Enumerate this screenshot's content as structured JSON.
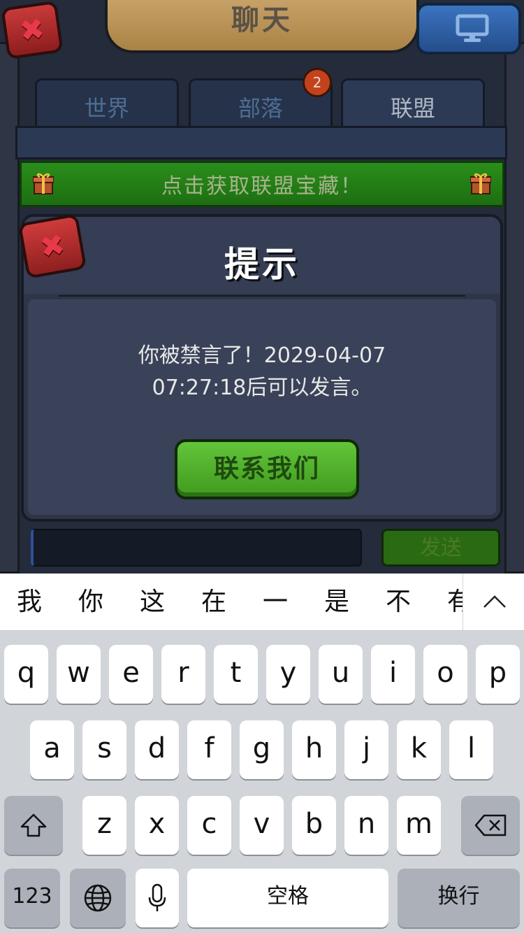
{
  "game": {
    "title": "聊天",
    "tabs": [
      {
        "label": "世界",
        "active": false
      },
      {
        "label": "部落",
        "active": false,
        "badge": "2"
      },
      {
        "label": "联盟",
        "active": true
      }
    ],
    "treasure_banner": "点击获取联盟宝藏！",
    "send_label": "发送"
  },
  "dialog": {
    "title": "提示",
    "message_line1": "你被禁言了！2029-04-07",
    "message_line2": "07:27:18后可以发言。",
    "contact_label": "联系我们"
  },
  "keyboard": {
    "candidates": [
      "我",
      "你",
      "这",
      "在",
      "一",
      "是",
      "不",
      "有"
    ],
    "row1": [
      "q",
      "w",
      "e",
      "r",
      "t",
      "y",
      "u",
      "i",
      "o",
      "p"
    ],
    "row2": [
      "a",
      "s",
      "d",
      "f",
      "g",
      "h",
      "j",
      "k",
      "l"
    ],
    "row3": [
      "z",
      "x",
      "c",
      "v",
      "b",
      "n",
      "m"
    ],
    "numbers_label": "123",
    "space_label": "空格",
    "return_label": "换行"
  },
  "colors": {
    "treasure_green": "#2a8e1a",
    "contact_green": "#4fb02a",
    "close_red": "#c93a3a",
    "badge_orange": "#c2431b",
    "keyboard_bg": "#d1d4d9"
  }
}
